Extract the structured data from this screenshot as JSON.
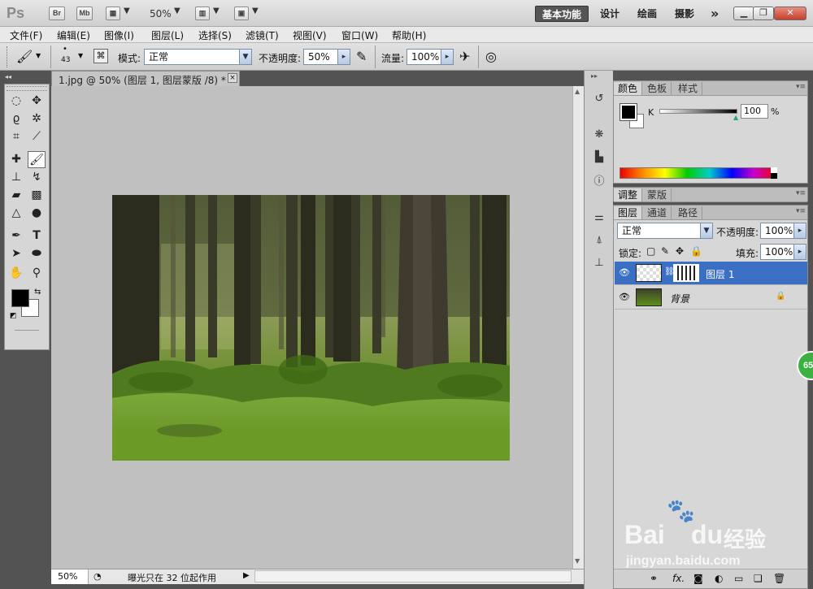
{
  "app": {
    "logo": "Ps",
    "bridge_label": "Br",
    "minibridge_label": "Mb",
    "zoom": "50%",
    "workspaces": [
      "基本功能",
      "设计",
      "绘画",
      "摄影"
    ],
    "more_label": "»"
  },
  "menu": [
    "文件(F)",
    "编辑(E)",
    "图像(I)",
    "图层(L)",
    "选择(S)",
    "滤镜(T)",
    "视图(V)",
    "窗口(W)",
    "帮助(H)"
  ],
  "options": {
    "brush_size": "43",
    "mode_label": "模式:",
    "mode_value": "正常",
    "opacity_label": "不透明度:",
    "opacity_value": "50%",
    "flow_label": "流量:",
    "flow_value": "100%"
  },
  "document": {
    "tab_title": "1.jpg @ 50% (图层 1, 图层蒙版 /8) *",
    "close_label": "×"
  },
  "status": {
    "zoom": "50%",
    "message": "曝光只在 32 位起作用"
  },
  "color_panel": {
    "tabs": [
      "颜色",
      "色板",
      "样式"
    ],
    "channel": "K",
    "value": "100",
    "unit": "%"
  },
  "adjust_panel": {
    "tabs": [
      "调整",
      "蒙版"
    ]
  },
  "layers_panel": {
    "tabs": [
      "图层",
      "通道",
      "路径"
    ],
    "blend_mode": "正常",
    "opacity_label": "不透明度:",
    "opacity_value": "100%",
    "lock_label": "锁定:",
    "fill_label": "填充:",
    "fill_value": "100%",
    "layers": [
      {
        "name": "图层 1"
      },
      {
        "name": "背景"
      }
    ],
    "footer_icons": [
      "link-icon",
      "fx-icon",
      "mask-icon",
      "adjustment-icon",
      "group-icon",
      "new-layer-icon",
      "trash-icon"
    ],
    "fx_label": "fx."
  },
  "badge": "65",
  "watermark": {
    "brand_bai": "Bai",
    "brand_du": "du",
    "brand_cn": "经验",
    "url": "jingyan.baidu.com"
  },
  "colors": {
    "selected_layer": "#3a6fc4",
    "badge_green": "#3cb043"
  }
}
